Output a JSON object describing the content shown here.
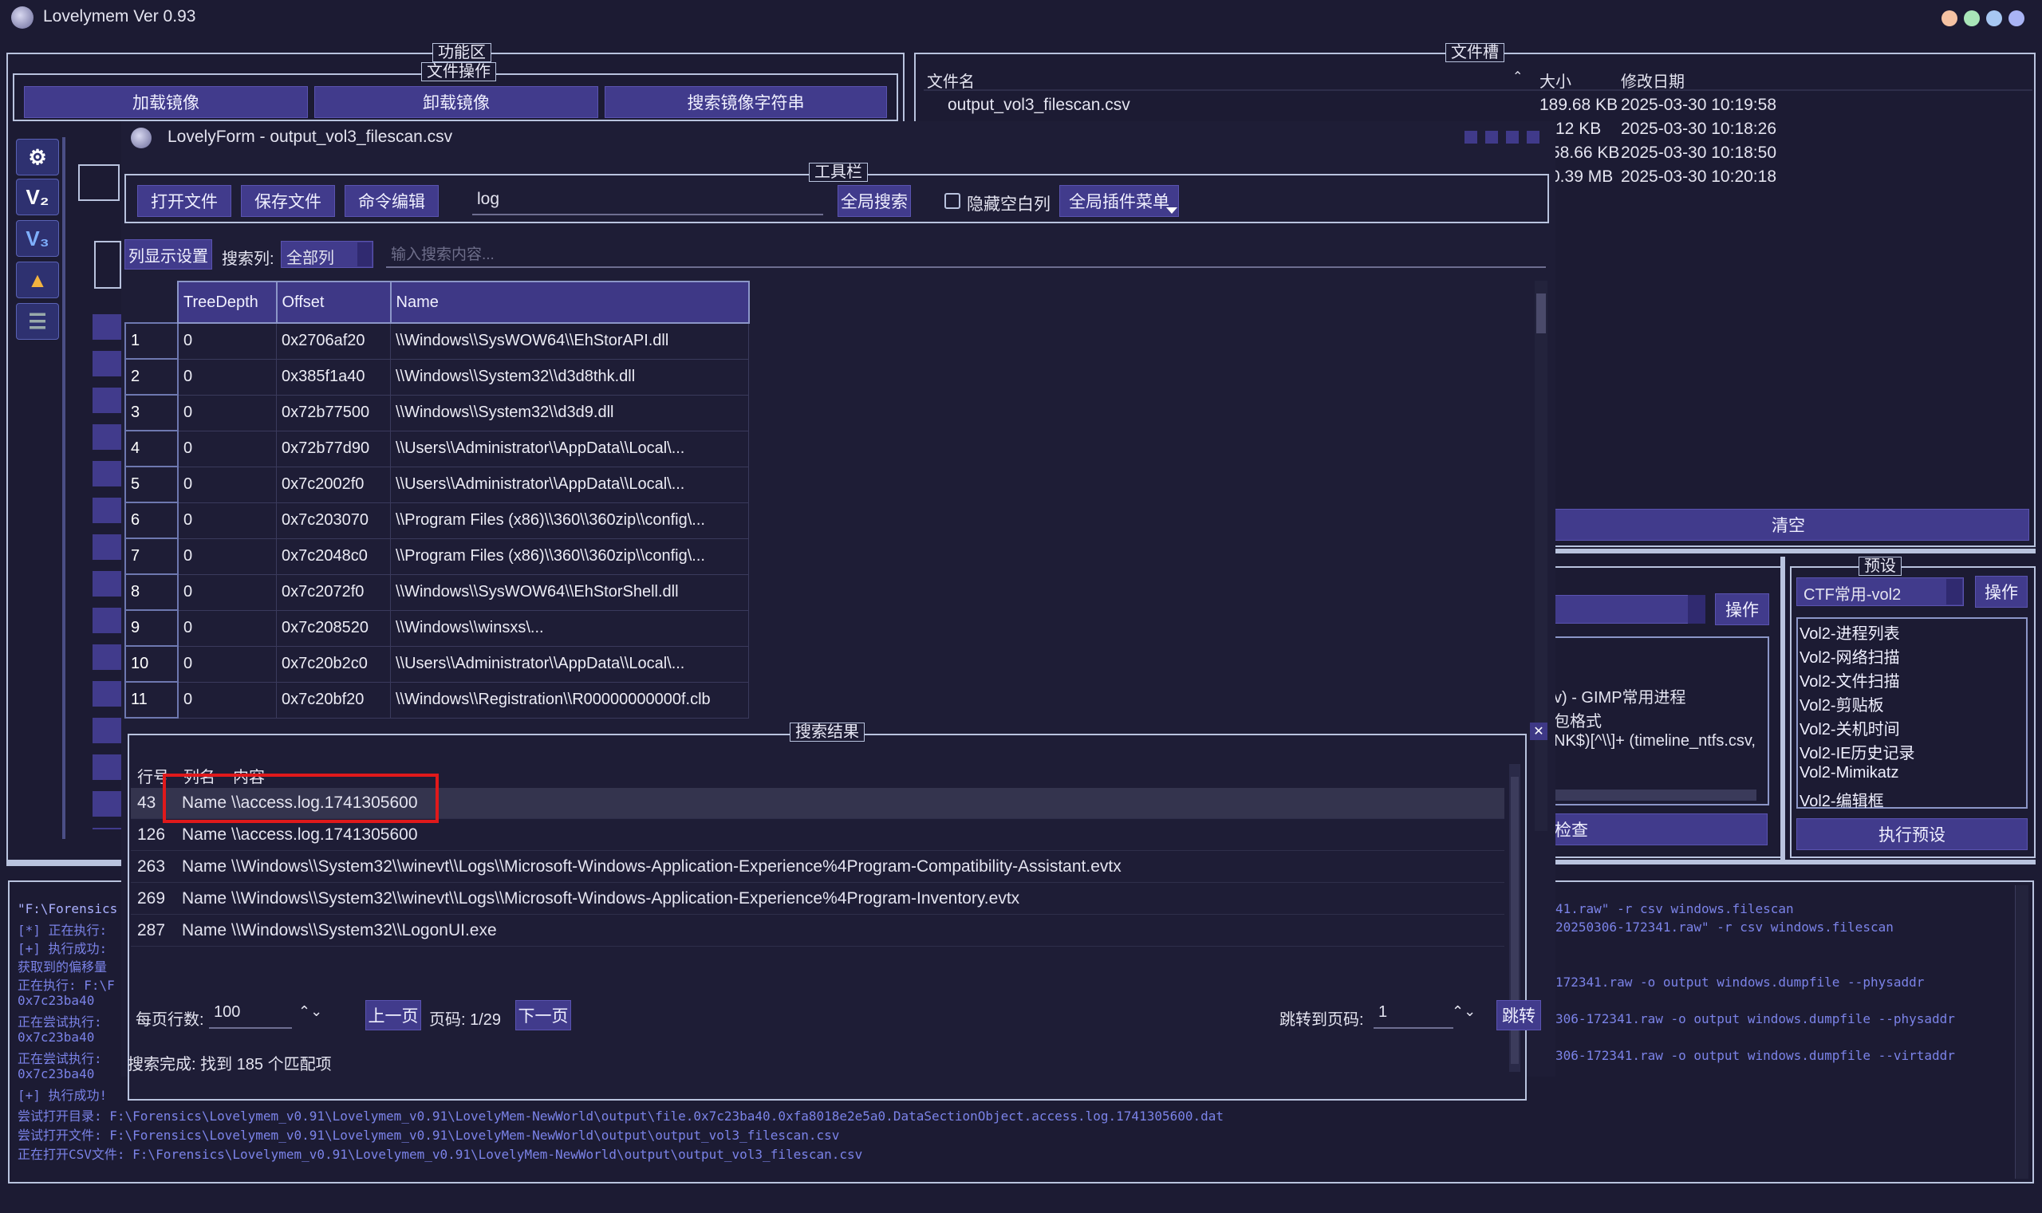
{
  "app": {
    "title": "Lovelymem Ver 0.93"
  },
  "window_controls": {
    "colors": [
      "#f5c2a3",
      "#a9e6b8",
      "#a7c7f2",
      "#a9b4f5"
    ]
  },
  "func_area": {
    "title": "功能区",
    "file_ops_title": "文件操作",
    "buttons": [
      "加载镜像",
      "卸载镜像",
      "搜索镜像字符串"
    ]
  },
  "file_slot": {
    "title": "文件槽",
    "headers": {
      "name": "文件名",
      "size": "大小",
      "modified": "修改日期"
    },
    "files": [
      {
        "name": "output_vol3_filescan.csv",
        "size": "189.68 KB",
        "modified": "2025-03-30 10:19:58"
      },
      {
        "name": "",
        "size": "12 KB",
        "modified": "2025-03-30 10:18:26"
      },
      {
        "name": "",
        "size": "58.66 KB",
        "modified": "2025-03-30 10:18:50"
      },
      {
        "name": "",
        "size": "0.39 MB",
        "modified": "2025-03-30 10:20:18"
      }
    ],
    "clear_button": "清空"
  },
  "presets": {
    "title": "预设",
    "selected": "CTF常用-vol2",
    "operate_button": "操作",
    "items": [
      "Vol2-进程列表",
      "Vol2-网络扫描",
      "Vol2-文件扫描",
      "Vol2-剪贴板",
      "Vol2-关机时间",
      "Vol2-IE历史记录",
      "Vol2-Mimikatz",
      "Vol2-编辑框"
    ],
    "run_button": "执行预设"
  },
  "middle_panel": {
    "operate_button": "操作",
    "lines": [
      "v) - GIMP常用进程",
      "包格式",
      "NK$)[^\\\\]+ (timeline_ntfs.csv,"
    ],
    "check_button": "检查"
  },
  "child": {
    "title": "LovelyForm - output_vol3_filescan.csv",
    "toolbar": {
      "title": "工具栏",
      "open": "打开文件",
      "save": "保存文件",
      "cmd_edit": "命令编辑",
      "search_value": "log",
      "global_search": "全局搜索",
      "hide_blank_cols": "隐藏空白列",
      "plugin_menu": "全局插件菜单"
    },
    "filter": {
      "col_display": "列显示设置",
      "search_col_label": "搜索列:",
      "search_col_value": "全部列",
      "search_placeholder": "输入搜索内容..."
    },
    "table": {
      "headers": [
        "TreeDepth",
        "Offset",
        "Name"
      ],
      "rows": [
        [
          "1",
          "0",
          "0x2706af20",
          "\\\\Windows\\\\SysWOW64\\\\EhStorAPI.dll"
        ],
        [
          "2",
          "0",
          "0x385f1a40",
          "\\\\Windows\\\\System32\\\\d3d8thk.dll"
        ],
        [
          "3",
          "0",
          "0x72b77500",
          "\\\\Windows\\\\System32\\\\d3d9.dll"
        ],
        [
          "4",
          "0",
          "0x72b77d90",
          "\\\\Users\\\\Administrator\\\\AppData\\\\Local\\..."
        ],
        [
          "5",
          "0",
          "0x7c2002f0",
          "\\\\Users\\\\Administrator\\\\AppData\\\\Local\\..."
        ],
        [
          "6",
          "0",
          "0x7c203070",
          "\\\\Program Files (x86)\\\\360\\\\360zip\\\\config\\..."
        ],
        [
          "7",
          "0",
          "0x7c2048c0",
          "\\\\Program Files (x86)\\\\360\\\\360zip\\\\config\\..."
        ],
        [
          "8",
          "0",
          "0x7c2072f0",
          "\\\\Windows\\\\SysWOW64\\\\EhStorShell.dll"
        ],
        [
          "9",
          "0",
          "0x7c208520",
          "\\\\Windows\\\\winsxs\\..."
        ],
        [
          "10",
          "0",
          "0x7c20b2c0",
          "\\\\Users\\\\Administrator\\\\AppData\\\\Local\\..."
        ],
        [
          "11",
          "0",
          "0x7c20bf20",
          "\\\\Windows\\\\Registration\\\\R00000000000f.clb"
        ]
      ]
    },
    "results": {
      "title": "搜索结果",
      "headers": {
        "row": "行号",
        "col": "列名",
        "content": "内容"
      },
      "rows": [
        {
          "row": "43",
          "col": "Name",
          "content": "\\\\access.log.1741305600"
        },
        {
          "row": "126",
          "col": "Name",
          "content": "\\\\access.log.1741305600"
        },
        {
          "row": "263",
          "col": "Name",
          "content": "\\\\Windows\\\\System32\\\\winevt\\\\Logs\\\\Microsoft-Windows-Application-Experience%4Program-Compatibility-Assistant.evtx"
        },
        {
          "row": "269",
          "col": "Name",
          "content": "\\\\Windows\\\\System32\\\\winevt\\\\Logs\\\\Microsoft-Windows-Application-Experience%4Program-Inventory.evtx"
        },
        {
          "row": "287",
          "col": "Name",
          "content": "\\\\Windows\\\\System32\\\\LogonUI.exe"
        }
      ]
    },
    "pager": {
      "rows_label": "每页行数:",
      "rows_value": "100",
      "prev": "上一页",
      "page_info": "页码: 1/29",
      "next": "下一页",
      "jump_label": "跳转到页码:",
      "jump_value": "1",
      "jump_btn": "跳转"
    },
    "status": "搜索完成: 找到 185 个匹配项"
  },
  "console": {
    "left_lines": [
      "\"F:\\Forensics",
      "[*] 正在执行:",
      "[+] 执行成功:",
      "获取到的偏移量",
      "正在执行: F:\\F",
      "0x7c23ba40",
      "正在尝试执行:",
      "0x7c23ba40",
      "正在尝试执行:",
      "0x7c23ba40",
      "[+] 执行成功!"
    ],
    "right_lines": [
      "41.raw\" -r csv windows.filescan",
      "20250306-172341.raw\" -r csv windows.filescan",
      "",
      "172341.raw -o output windows.dumpfile --physaddr",
      "",
      "306-172341.raw -o output windows.dumpfile --physaddr",
      "",
      "306-172341.raw -o output windows.dumpfile --virtaddr"
    ],
    "bottom_lines": [
      "尝试打开目录: F:\\Forensics\\Lovelymem_v0.91\\Lovelymem_v0.91\\LovelyMem-NewWorld\\output\\file.0x7c23ba40.0xfa8018e2e5a0.DataSectionObject.access.log.1741305600.dat",
      "尝试打开文件: F:\\Forensics\\Lovelymem_v0.91\\Lovelymem_v0.91\\LovelyMem-NewWorld\\output\\output_vol3_filescan.csv",
      "正在打开CSV文件: F:\\Forensics\\Lovelymem_v0.91\\Lovelymem_v0.91\\LovelyMem-NewWorld\\output\\output_vol3_filescan.csv"
    ]
  },
  "sidebar": {
    "icons": [
      "gear-app-icon",
      "v2-icon",
      "v3-icon",
      "folder-tool-icon",
      "list-tool-icon"
    ],
    "icon_labels": [
      "",
      "V₂",
      "V₃",
      "",
      ""
    ]
  },
  "highlight_color": "#e0191b"
}
